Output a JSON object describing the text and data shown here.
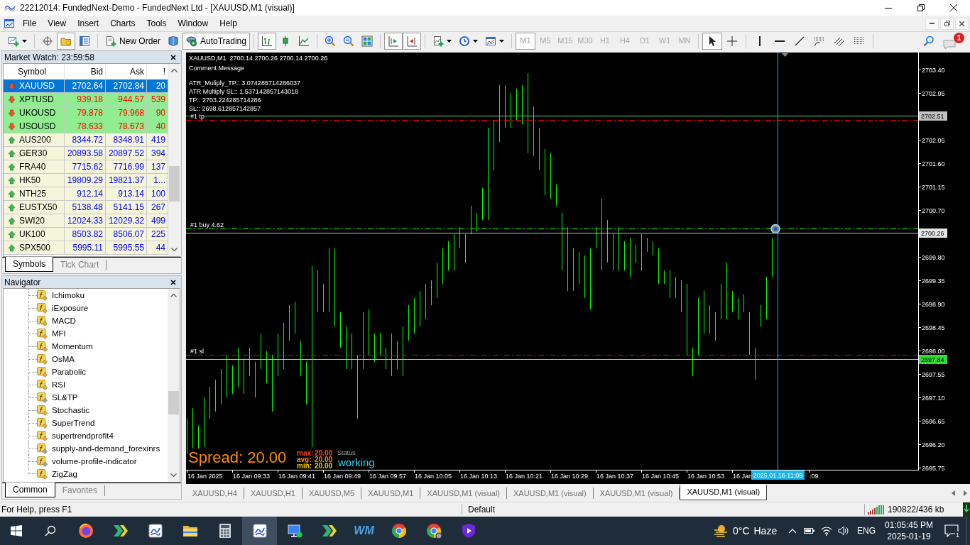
{
  "window": {
    "title": "22212014: FundedNext-Demo - FundedNext Ltd - [XAUUSD,M1 (visual)]"
  },
  "menu": [
    "File",
    "View",
    "Insert",
    "Charts",
    "Tools",
    "Window",
    "Help"
  ],
  "toolbar": {
    "buttons": [
      {
        "pressed": false
      },
      {
        "pressed": false
      },
      {
        "pressed": true
      },
      {
        "pressed": false
      },
      {
        "label": "New Order",
        "pressed": false
      },
      {
        "pressed": false
      },
      {
        "label": "AutoTrading",
        "pressed": true
      },
      {
        "pressed": true
      },
      {
        "pressed": false
      },
      {
        "pressed": false
      },
      {
        "pressed": false
      },
      {
        "pressed": false
      },
      {
        "pressed": false
      },
      {
        "pressed": true
      },
      {
        "pressed": true
      },
      {
        "pressed": false
      },
      {
        "pressed": false
      },
      {
        "pressed": false
      }
    ],
    "timeframes": [
      {
        "label": "M1",
        "selected": true,
        "disabled": true
      },
      {
        "label": "M5",
        "selected": false,
        "disabled": true
      },
      {
        "label": "M15",
        "selected": false,
        "disabled": true
      },
      {
        "label": "M30",
        "selected": false,
        "disabled": true
      },
      {
        "label": "H1",
        "selected": false,
        "disabled": true
      },
      {
        "label": "H4",
        "selected": false,
        "disabled": true
      },
      {
        "label": "D1",
        "selected": false,
        "disabled": true
      },
      {
        "label": "W1",
        "selected": false,
        "disabled": true
      },
      {
        "label": "MN",
        "selected": false,
        "disabled": true
      }
    ],
    "drawing_tools": [
      {
        "pressed": true
      },
      {
        "pressed": false
      },
      {
        "pressed": false
      },
      {
        "pressed": false
      },
      {
        "pressed": false
      },
      {
        "pressed": false
      },
      {
        "pressed": false
      },
      {
        "pressed": false
      }
    ],
    "notification_count": "1"
  },
  "market_watch": {
    "title": "Market Watch: 23:59:58",
    "columns": [
      "Symbol",
      "Bid",
      "Ask",
      "!"
    ],
    "rows": [
      {
        "symbol": "XAUUSD",
        "bid": "2702.64",
        "ask": "2702.84",
        "spread": "20",
        "kind": "down",
        "selected": true
      },
      {
        "symbol": "XPTUSD",
        "bid": "939.18",
        "ask": "944.57",
        "spread": "539",
        "kind": "down",
        "highlighted": true,
        "selected": false
      },
      {
        "symbol": "UKOUSD",
        "bid": "79.878",
        "ask": "79.968",
        "spread": "90",
        "kind": "down",
        "highlighted": true,
        "selected": false
      },
      {
        "symbol": "USOUSD",
        "bid": "78.633",
        "ask": "78.673",
        "spread": "40",
        "kind": "down",
        "highlighted": true,
        "selected": false
      },
      {
        "symbol": "AUS200",
        "bid": "8344.72",
        "ask": "8348.91",
        "spread": "419",
        "kind": "up",
        "highlighted": false,
        "selected": false
      },
      {
        "symbol": "GER30",
        "bid": "20893.58",
        "ask": "20897.52",
        "spread": "394",
        "kind": "up",
        "highlighted": false,
        "selected": false
      },
      {
        "symbol": "FRA40",
        "bid": "7715.62",
        "ask": "7716.99",
        "spread": "137",
        "kind": "up",
        "highlighted": false,
        "selected": false
      },
      {
        "symbol": "HK50",
        "bid": "19809.29",
        "ask": "19821.37",
        "spread": "1...",
        "kind": "up",
        "highlighted": false,
        "selected": false
      },
      {
        "symbol": "NTH25",
        "bid": "912.14",
        "ask": "913.14",
        "spread": "100",
        "kind": "up",
        "highlighted": false,
        "selected": false
      },
      {
        "symbol": "EUSTX50",
        "bid": "5138.48",
        "ask": "5141.15",
        "spread": "267",
        "kind": "up",
        "highlighted": false,
        "selected": false
      },
      {
        "symbol": "SWI20",
        "bid": "12024.33",
        "ask": "12029.32",
        "spread": "499",
        "kind": "up",
        "highlighted": false,
        "selected": false
      },
      {
        "symbol": "UK100",
        "bid": "8503.82",
        "ask": "8506.07",
        "spread": "225",
        "kind": "up",
        "highlighted": false,
        "selected": false
      },
      {
        "symbol": "SPX500",
        "bid": "5995.11",
        "ask": "5995.55",
        "spread": "44",
        "kind": "up",
        "highlighted": false,
        "selected": false
      }
    ],
    "tabs": [
      {
        "label": "Symbols",
        "selected": true
      },
      {
        "label": "Tick Chart",
        "selected": false
      }
    ]
  },
  "navigator": {
    "title": "Navigator",
    "items": [
      {
        "label": "Ichimoku",
        "kind": "gold_badge"
      },
      {
        "label": "iExposure",
        "kind": "gold_badge"
      },
      {
        "label": "MACD",
        "kind": "gold_badge"
      },
      {
        "label": "MFI",
        "kind": "gold_badge"
      },
      {
        "label": "Momentum",
        "kind": "gold_badge"
      },
      {
        "label": "OsMA",
        "kind": "gold_badge"
      },
      {
        "label": "Parabolic",
        "kind": "gold_badge"
      },
      {
        "label": "RSI",
        "kind": "gold_badge"
      },
      {
        "label": "SL&TP",
        "kind": "grey_badge"
      },
      {
        "label": "Stochastic",
        "kind": "gold_badge"
      },
      {
        "label": "SuperTrend",
        "kind": "gold_badge"
      },
      {
        "label": "supertrendprofit4",
        "kind": "gold_badge"
      },
      {
        "label": "supply-and-demand_forexinrs",
        "kind": "grey_badge"
      },
      {
        "label": "volume-profile-indicator",
        "kind": "grey_badge"
      },
      {
        "label": "ZigZag",
        "kind": "gold_badge"
      }
    ],
    "tabs": [
      {
        "label": "Common",
        "selected": true
      },
      {
        "label": "Favorites",
        "selected": false
      }
    ]
  },
  "chart": {
    "header": "XAUUSD,M1  2700.14 2700.26 2700.14 2700.26",
    "comment_title": "Comment Message",
    "comment_lines": [
      "ATR_Muliply_TP:: 3.074285714286037",
      "ATR Multiply SL:: 1.537142857143018",
      "TP:: 2703.224285714286",
      "SL:: 2698.612857142857"
    ],
    "price_axis": [
      "2703.40",
      "2702.95",
      "2702.05",
      "2701.60",
      "2701.15",
      "2700.70",
      "2699.80",
      "2699.35",
      "2698.90",
      "2698.45",
      "2698.00",
      "2697.55",
      "2697.10",
      "2696.65",
      "2696.20",
      "2695.75"
    ],
    "time_axis": [
      "16 Jan 2025",
      "16 Jan 09:33",
      "16 Jan 09:41",
      "16 Jan 09:49",
      "16 Jan 09:57",
      "16 Jan 10:05",
      "16 Jan 10:13",
      "16 Jan 10:21",
      "16 Jan 10:29",
      "16 Jan 10:37",
      "16 Jan 10:45",
      "16 Jan 10:53",
      "16 Jan",
      ":09"
    ],
    "price_levels": [
      {
        "color": "#5fcf9a",
        "tag": {
          "label": "2702.51",
          "color": "#c0c0c0"
        }
      },
      {
        "color": "#c0c0c0",
        "tag": {
          "label": "2700.26",
          "color": "#e6e6e6"
        }
      },
      {
        "color": "#c0c0c0",
        "tag": {
          "label": "2697.84",
          "color": "#33dd33"
        }
      }
    ],
    "order_lines": [
      {
        "label": "#1 tp",
        "color": "#ff0000"
      },
      {
        "label": "#1 buy 4.62",
        "color": "#00ff00"
      },
      {
        "label": "#1 sl",
        "color": "#ff0000"
      }
    ],
    "time_marker": "2025.01.16 11:09",
    "spread": {
      "text": "Spread: 20.00",
      "stats": [
        {
          "label": "max:",
          "value": "20.00",
          "color": "#ff4020"
        },
        {
          "label": "avg:",
          "value": "20.00",
          "color": "#ff8c00"
        },
        {
          "label": "min:",
          "value": "20.00",
          "color": "#ffcc00"
        }
      ]
    },
    "status": {
      "label": "Status",
      "value": "working"
    }
  },
  "chart_tabs": [
    {
      "label": "XAUUSD,H4",
      "selected": false
    },
    {
      "label": "XAUUSD,H1",
      "selected": false
    },
    {
      "label": "XAUUSD,M5",
      "selected": false
    },
    {
      "label": "XAUUSD,M1",
      "selected": false
    },
    {
      "label": "XAUUSD,M1 (visual)",
      "selected": false
    },
    {
      "label": "XAUUSD,M1 (visual)",
      "selected": false
    },
    {
      "label": "XAUUSD,M1 (visual)",
      "selected": false
    },
    {
      "label": "XAUUSD,M1 (visual)",
      "selected": true
    }
  ],
  "status_bar": {
    "help": "For Help, press F1",
    "profile": "Default",
    "traffic": "190822/436 kb"
  },
  "taskbar": {
    "apps": [
      {
        "active": false
      },
      {
        "active": false
      },
      {
        "active": false
      },
      {
        "active": false
      },
      {
        "active": false
      },
      {
        "active": true
      },
      {
        "active": false
      },
      {
        "active": false
      },
      {
        "active": false,
        "label": "WM"
      },
      {
        "active": false
      },
      {
        "active": false
      },
      {
        "active": false
      }
    ],
    "weather": {
      "temperature": "0°C",
      "condition": "Haze"
    },
    "language": "ENG",
    "time": "01:05:45 PM",
    "date": "2025-01-19",
    "notification_count": "1"
  }
}
